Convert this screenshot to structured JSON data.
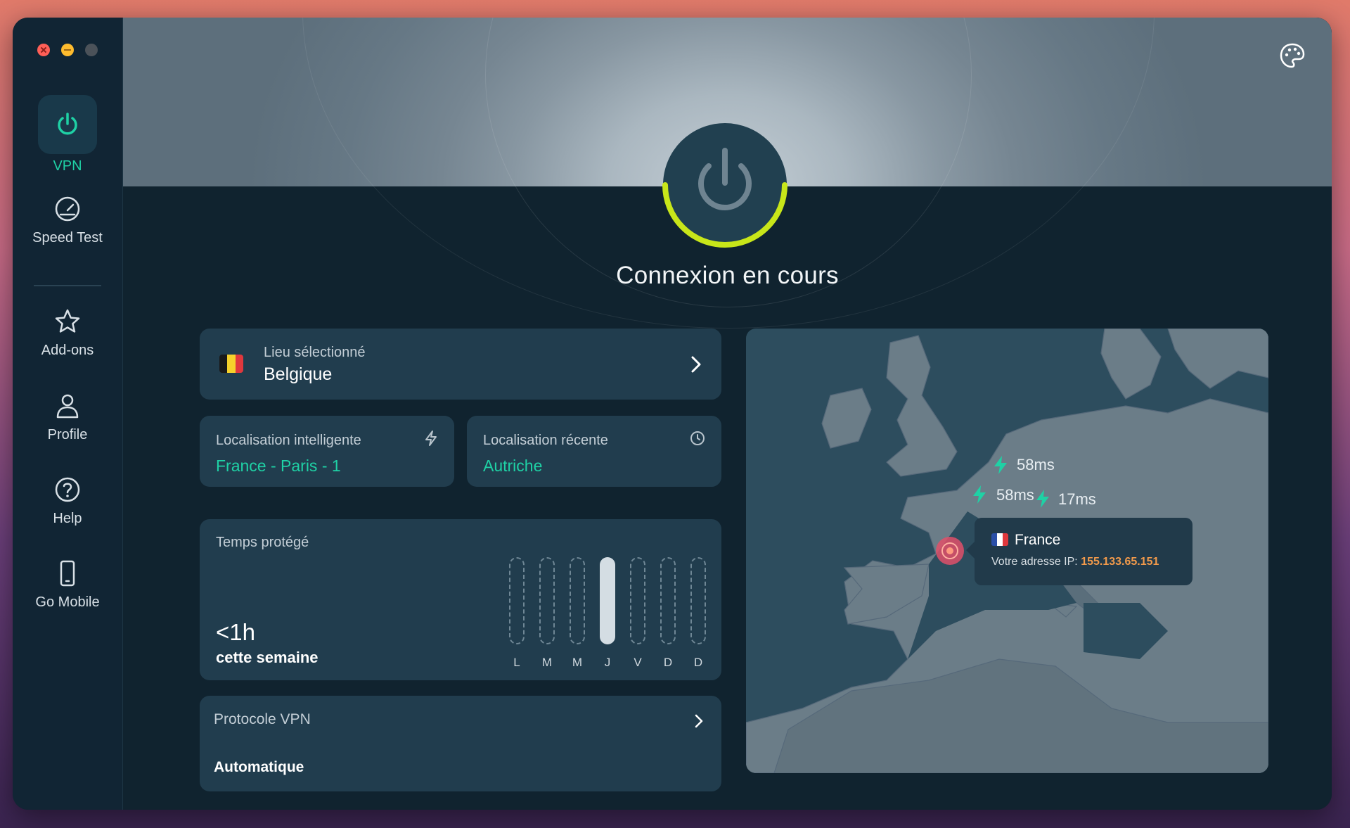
{
  "sidebar": {
    "items": [
      {
        "label": "VPN",
        "icon": "power-icon",
        "active": true
      },
      {
        "label": "Speed Test",
        "icon": "speedometer-icon"
      },
      {
        "label": "Add-ons",
        "icon": "star-icon"
      },
      {
        "label": "Profile",
        "icon": "person-icon"
      },
      {
        "label": "Help",
        "icon": "help-icon"
      },
      {
        "label": "Go Mobile",
        "icon": "phone-icon"
      }
    ]
  },
  "status": {
    "title": "Connexion en cours"
  },
  "selected_location": {
    "label": "Lieu sélectionné",
    "value": "Belgique",
    "flag": "be"
  },
  "smart_location": {
    "label": "Localisation intelligente",
    "value": "France - Paris - 1"
  },
  "recent_location": {
    "label": "Localisation récente",
    "value": "Autriche"
  },
  "protected_time": {
    "label": "Temps protégé",
    "value": "<1h",
    "sub": "cette semaine",
    "days": [
      "L",
      "M",
      "M",
      "J",
      "V",
      "D",
      "D"
    ],
    "active_day_index": 3
  },
  "protocol": {
    "label": "Protocole VPN",
    "value": "Automatique"
  },
  "map": {
    "pings": [
      "58ms",
      "58ms",
      "17ms"
    ],
    "tooltip": {
      "country": "France",
      "ip_label": "Votre adresse IP:",
      "ip": "155.133.65.151"
    }
  },
  "colors": {
    "accent": "#1fd1a5",
    "progress": "#c8e619",
    "ip": "#f29a4b",
    "pin": "#e0506a"
  }
}
